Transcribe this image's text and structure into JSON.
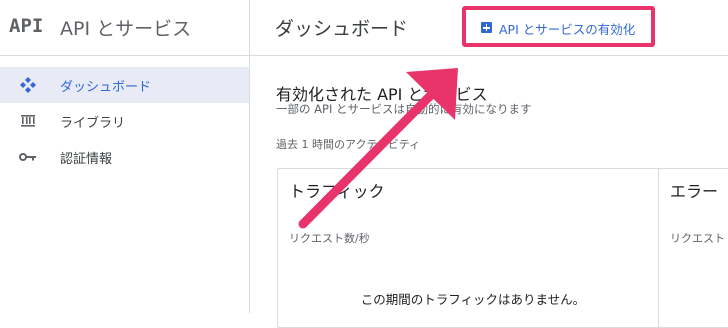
{
  "sidebar": {
    "logo": "API",
    "title": "API とサービス",
    "items": [
      {
        "label": "ダッシュボード",
        "active": true,
        "icon": "dashboard-diamond-icon"
      },
      {
        "label": "ライブラリ",
        "active": false,
        "icon": "library-icon"
      },
      {
        "label": "認証情報",
        "active": false,
        "icon": "key-icon"
      }
    ]
  },
  "header": {
    "title": "ダッシュボード",
    "enable_button": "API とサービスの有効化"
  },
  "main": {
    "section_title": "有効化された API とサービス",
    "section_subtitle": "一部の API とサービスは自動的に有効になります",
    "activity_label": "過去 1 時間のアクティビティ",
    "cards": [
      {
        "title": "トラフィック",
        "metric": "リクエスト数/秒",
        "empty": "この期間のトラフィックはありません。"
      },
      {
        "title": "エラー",
        "metric": "リクエスト"
      }
    ]
  },
  "colors": {
    "accent": "#3367d6",
    "highlight": "#e8336b",
    "active_bg": "#e8eaf6"
  }
}
